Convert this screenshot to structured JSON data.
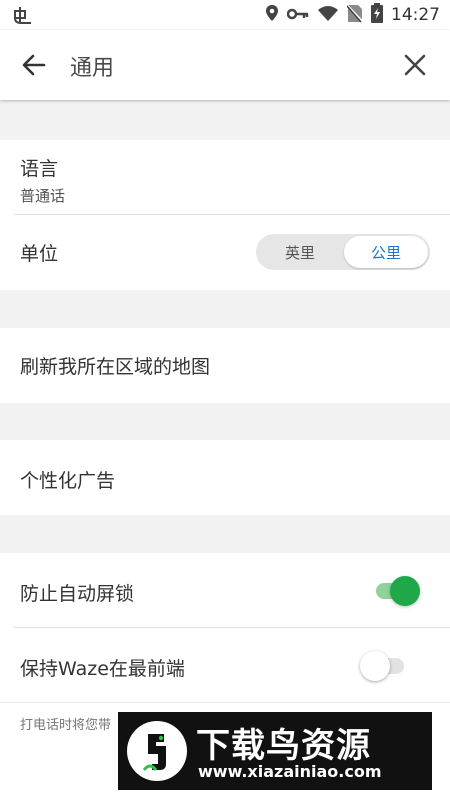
{
  "status_bar": {
    "time": "14:27",
    "icons": [
      "bug-icon",
      "location-icon",
      "vpn-key-icon",
      "wifi-icon",
      "no-sim-icon",
      "battery-icon"
    ]
  },
  "app_bar": {
    "title": "通用",
    "back_icon": "back-arrow-icon",
    "close_icon": "close-icon"
  },
  "settings": {
    "language": {
      "label": "语言",
      "value": "普通话"
    },
    "units": {
      "label": "单位",
      "options": [
        "英里",
        "公里"
      ],
      "selected": "公里"
    },
    "refresh_map": {
      "label": "刷新我所在区域的地图"
    },
    "personalized_ads": {
      "label": "个性化广告"
    },
    "prevent_autolock": {
      "label": "防止自动屏锁",
      "enabled": true
    },
    "keep_waze_front": {
      "label": "保持Waze在最前端",
      "enabled": false
    },
    "footnote": "打电话时将您带"
  },
  "watermark": {
    "text": "下载鸟资源",
    "url": "www.xiazainiao.com"
  },
  "colors": {
    "accent_blue": "#1976d2",
    "toggle_on": "#1fa84a",
    "toggle_on_track": "#8fd39b"
  }
}
